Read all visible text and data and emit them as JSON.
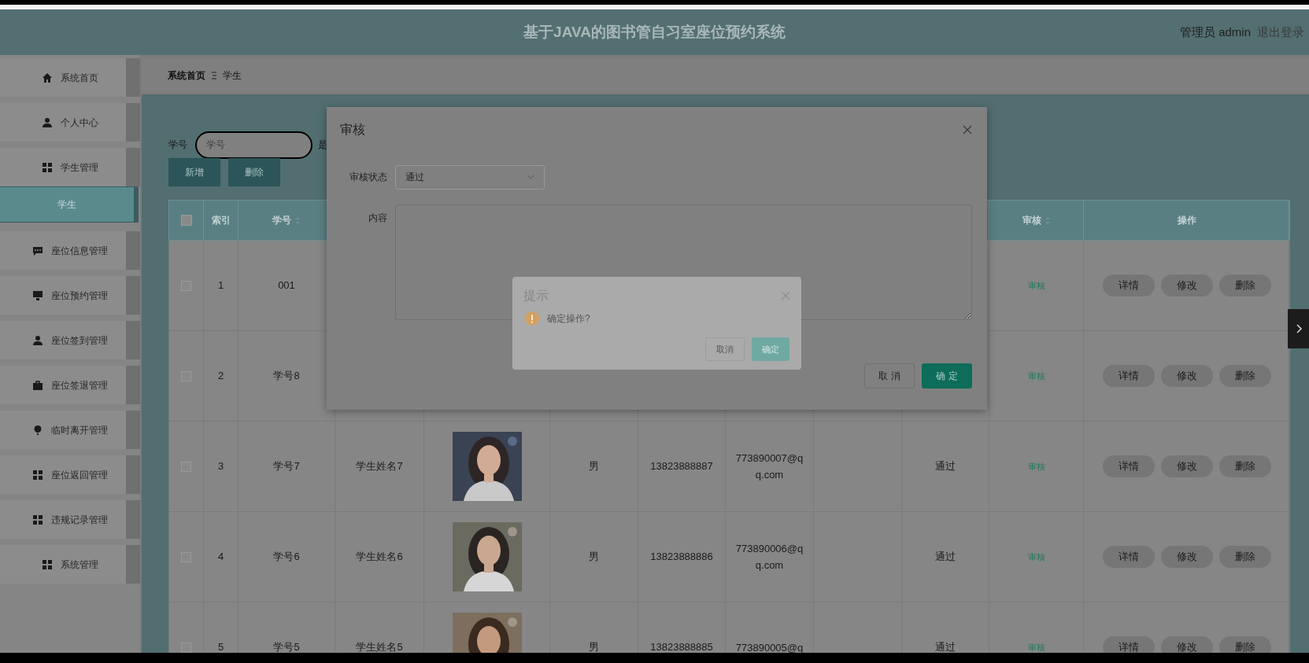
{
  "header": {
    "title": "基于JAVA的图书管自习室座位预约系统",
    "user": "管理员 admin",
    "logout": "退出登录"
  },
  "sidebar": {
    "items": [
      {
        "label": "系统首页",
        "selected": false
      },
      {
        "label": "个人中心",
        "selected": false
      },
      {
        "label": "学生管理",
        "selected": false,
        "children": [
          {
            "label": "学生",
            "selected": true
          }
        ]
      },
      {
        "label": "座位信息管理",
        "selected": false
      },
      {
        "label": "座位预约管理",
        "selected": false
      },
      {
        "label": "座位签到管理",
        "selected": false
      },
      {
        "label": "座位签退管理",
        "selected": false
      },
      {
        "label": "临时离开管理",
        "selected": false
      },
      {
        "label": "座位返回管理",
        "selected": false
      },
      {
        "label": "违规记录管理",
        "selected": false
      },
      {
        "label": "系统管理",
        "selected": false
      }
    ]
  },
  "breadcrumb": [
    "系统首页",
    "学生"
  ],
  "search": {
    "label": "学号",
    "placeholder": "学号",
    "next_label": "是"
  },
  "toolbar": [
    "新增",
    "删除"
  ],
  "table": {
    "select_all": {
      "checked": false
    },
    "columns": [
      {
        "label": "索引",
        "sortable": false
      },
      {
        "label": "学号",
        "sortable": true
      },
      {
        "label": "审核",
        "sortable": true
      },
      {
        "label": "操作",
        "sortable": false
      }
    ],
    "rows": [
      {
        "checked": false,
        "index": "1",
        "student_id": "001",
        "review": "审核",
        "actions": [
          "详情",
          "修改",
          "删除"
        ]
      },
      {
        "checked": false,
        "index": "2",
        "student_id": "学号8",
        "review": "审核",
        "actions": [
          "详情",
          "修改",
          "删除"
        ]
      },
      {
        "checked": false,
        "index": "3",
        "student_id": "学号7",
        "name": "学生姓名7",
        "photo": {
          "kind": "picture"
        },
        "gender": "男",
        "phone": "13823888887",
        "email": "773890007@qq.com",
        "status": "通过",
        "review": "审核",
        "actions": [
          "详情",
          "修改",
          "删除"
        ]
      },
      {
        "checked": false,
        "index": "4",
        "student_id": "学号6",
        "name": "学生姓名6",
        "photo": {
          "kind": "picture"
        },
        "gender": "男",
        "phone": "13823888886",
        "email": "773890006@qq.com",
        "status": "通过",
        "review": "审核",
        "actions": [
          "详情",
          "修改",
          "删除"
        ]
      },
      {
        "checked": false,
        "index": "5",
        "student_id": "学号5",
        "name": "学生姓名5",
        "photo": {
          "kind": "picture"
        },
        "gender": "男",
        "phone": "13823888885",
        "email": "773890005@q",
        "status": "通过",
        "review": "审核",
        "actions": [
          "详情",
          "修改",
          "删除"
        ]
      }
    ]
  },
  "review_dialog": {
    "title": "审核",
    "status_label": "审核状态",
    "status_value": "通过",
    "content_label": "内容",
    "cancel": "取 消",
    "confirm": "确 定"
  },
  "confirm_dialog": {
    "title": "提示",
    "message": "确定操作?",
    "cancel": "取消",
    "confirm": "确定"
  }
}
